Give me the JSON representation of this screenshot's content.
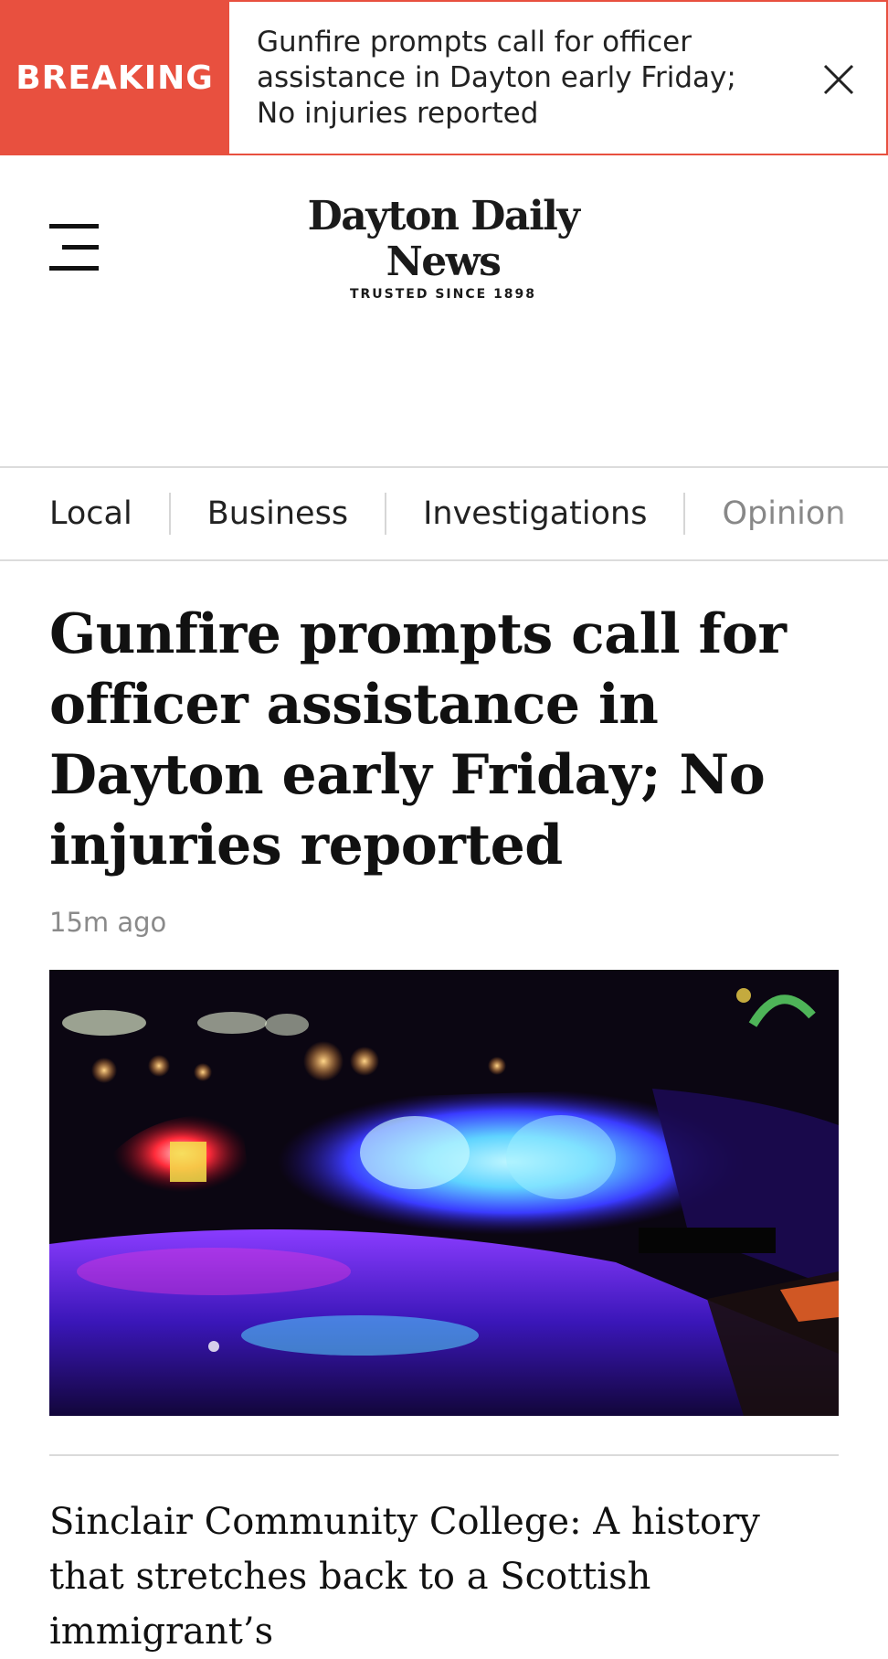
{
  "breaking": {
    "tag": "BREAKING",
    "text": "Gunfire prompts call for officer assistance in Dayton early Friday; No injuries reported"
  },
  "header": {
    "logo_name": "Dayton Daily News",
    "logo_tagline": "TRUSTED SINCE 1898"
  },
  "sections": [
    "Local",
    "Business",
    "Investigations",
    "Opinion"
  ],
  "article": {
    "headline": "Gunfire prompts call for officer assistance in Dayton early Friday; No injuries reported",
    "timestamp": "15m ago",
    "image_icon": "police-lights-photo"
  },
  "related": {
    "title": "Sinclair Community College: A history that stretches back to a Scottish immigrant’s"
  },
  "colors": {
    "breaking_red": "#e8503f",
    "text": "#1a1a1a",
    "muted": "#8a8a8a"
  }
}
